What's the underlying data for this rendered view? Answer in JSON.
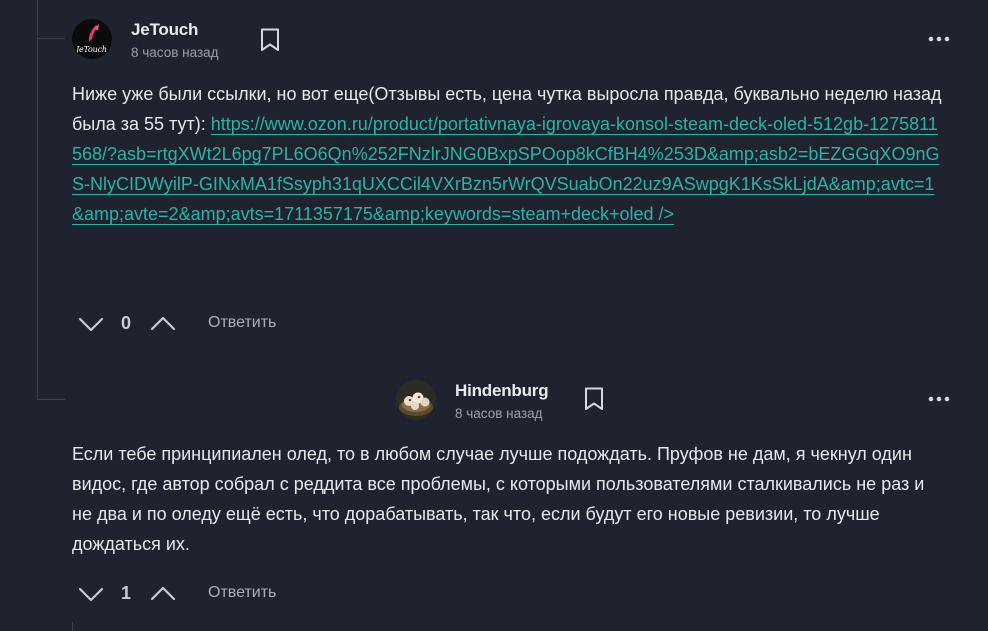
{
  "comments": [
    {
      "author": "JeTouch",
      "avatar_text": "JeTouch",
      "time": "8 часов назад",
      "text_before_link": "Ниже уже были ссылки, но вот еще(Отзывы есть, цена чутка выросла правда, буквально неделю назад была за 55 тут): ",
      "link": "https://www.ozon.ru/product/portativnaya-igrovaya-konsol-steam-deck-oled-512gb-1275811568/?asb=rtgXWt2L6pg7PL6O6Qn%252FNzlrJNG0BxpSPOop8kCfBH4%253D&amp;asb2=bEZGGqXO9nGS-NlyCIDWyilP-GINxMA1fSsyph31qUXCCil4VXrBzn5rWrQVSuabOn22uz9ASwpgK1KsSkLjdA&amp;avtc=1&amp;avte=2&amp;avts=1711357175&amp;keywords=steam+deck+oled />",
      "votes": "0",
      "reply_label": "Ответить"
    },
    {
      "author": "Hindenburg",
      "time": "8 часов назад",
      "text": "Если тебе принципиален олед, то в любом случае лучше подождать. Пруфов не дам, я чекнул один видос, где автор собрал с реддита все проблемы, с которыми пользователями сталкивались не раз и не два и по оледу ещё есть, что дорабатывать, так что, если будут его новые ревизии, то лучше дождаться их.",
      "votes": "1",
      "reply_label": "Ответить"
    }
  ],
  "icons": {
    "bookmark": "bookmark-icon",
    "more": "more-dots-icon",
    "vote_down": "chevron-down-icon",
    "vote_up": "chevron-up-icon"
  },
  "colors": {
    "background": "#1f2330",
    "link": "#2bb3a3",
    "text": "#e6e8ec",
    "muted": "#9aa0ab",
    "avatar_logo": "#e0366f"
  }
}
